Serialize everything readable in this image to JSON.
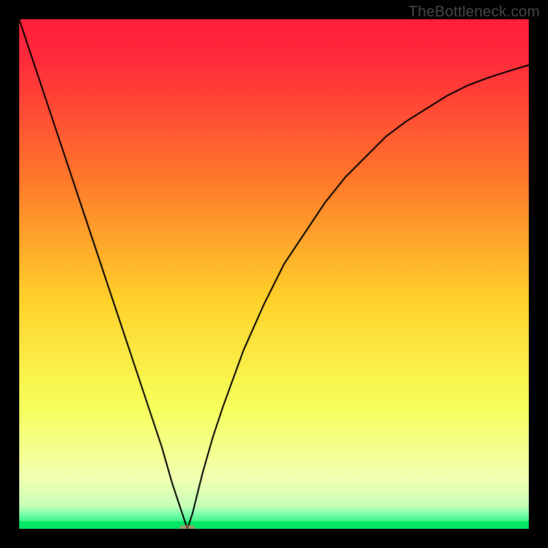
{
  "watermark": "TheBottleneck.com",
  "chart_data": {
    "type": "line",
    "title": "",
    "xlabel": "",
    "ylabel": "",
    "xlim": [
      0,
      100
    ],
    "ylim": [
      0,
      100
    ],
    "background_gradient": {
      "from_color": "#ff2a3b",
      "through": [
        "#ff8a2a",
        "#ffe62a",
        "#f7ff8a"
      ],
      "to_color": "#00e864",
      "bottom_band_color": "#00e864"
    },
    "marker": {
      "x": 33,
      "y": 0,
      "color": "#ff7a7a",
      "shape": "rounded-rect"
    },
    "series": [
      {
        "name": "curve",
        "color": "#000000",
        "x": [
          0,
          2,
          4,
          6,
          8,
          10,
          12,
          14,
          16,
          18,
          20,
          22,
          24,
          26,
          28,
          30,
          31,
          32,
          33,
          34,
          35,
          36,
          38,
          40,
          44,
          48,
          52,
          56,
          60,
          64,
          68,
          72,
          76,
          80,
          84,
          88,
          92,
          96,
          100
        ],
        "y": [
          100,
          94,
          88,
          82,
          76,
          70,
          64,
          58,
          52,
          46,
          40,
          34,
          28,
          22,
          16,
          9,
          6,
          3,
          0,
          3,
          7,
          11,
          18,
          24,
          35,
          44,
          52,
          58,
          64,
          69,
          73,
          77,
          80,
          82.5,
          85,
          87,
          88.5,
          89.8,
          91
        ]
      }
    ]
  }
}
